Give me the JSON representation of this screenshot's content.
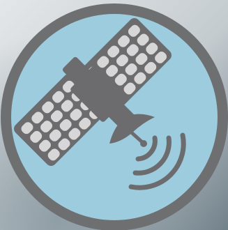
{
  "icon": {
    "name": "satellite-icon",
    "colors": {
      "background_light": "#dfe3e6",
      "background_dark": "#7d8b93",
      "ring": "#6e6f71",
      "disc": "#9cccde",
      "satellite": "#6c6c6e",
      "cells": "#d7d7d7"
    }
  }
}
